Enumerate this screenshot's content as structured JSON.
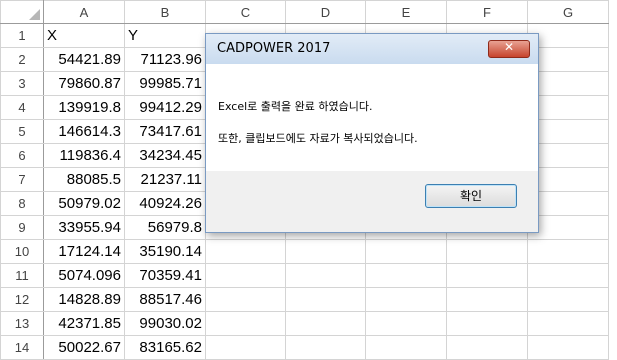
{
  "spreadsheet": {
    "columns": [
      "A",
      "B",
      "C",
      "D",
      "E",
      "F",
      "G"
    ],
    "rows": [
      {
        "n": "1",
        "a": "X",
        "b": "Y"
      },
      {
        "n": "2",
        "a": "54421.89",
        "b": "71123.96"
      },
      {
        "n": "3",
        "a": "79860.87",
        "b": "99985.71"
      },
      {
        "n": "4",
        "a": "139919.8",
        "b": "99412.29"
      },
      {
        "n": "5",
        "a": "146614.3",
        "b": "73417.61"
      },
      {
        "n": "6",
        "a": "119836.4",
        "b": "34234.45"
      },
      {
        "n": "7",
        "a": "88085.5",
        "b": "21237.11"
      },
      {
        "n": "8",
        "a": "50979.02",
        "b": "40924.26"
      },
      {
        "n": "9",
        "a": "33955.94",
        "b": "56979.8"
      },
      {
        "n": "10",
        "a": "17124.14",
        "b": "35190.14"
      },
      {
        "n": "11",
        "a": "5074.096",
        "b": "70359.41"
      },
      {
        "n": "12",
        "a": "14828.89",
        "b": "88517.46"
      },
      {
        "n": "13",
        "a": "42371.85",
        "b": "99030.02"
      },
      {
        "n": "14",
        "a": "50022.67",
        "b": "83165.62"
      }
    ]
  },
  "dialog": {
    "title": "CADPOWER 2017",
    "close_icon": "close-x-icon",
    "message_line1": "Excel로 출력을 완료 하였습니다.",
    "message_line2": "또한, 클립보드에도 자료가 복사되었습니다.",
    "ok_label": "확인"
  },
  "colors": {
    "grid_line": "#d4d4d4",
    "dialog_border": "#7a9ac2",
    "close_button": "#c7432c",
    "ok_button_border": "#3c7fb1"
  }
}
